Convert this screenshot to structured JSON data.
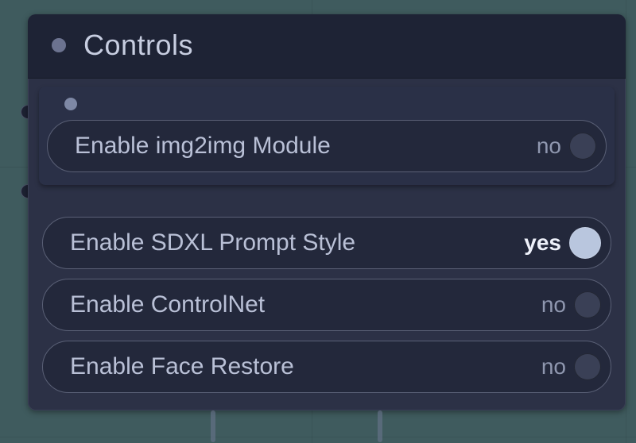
{
  "panel": {
    "title": "Controls",
    "toggles": [
      {
        "id": "img2img",
        "label": "Enable img2img Module",
        "value": "no",
        "on": false
      },
      {
        "id": "sdxl-style",
        "label": "Enable SDXL Prompt Style",
        "value": "yes",
        "on": true
      },
      {
        "id": "controlnet",
        "label": "Enable ControlNet",
        "value": "no",
        "on": false
      },
      {
        "id": "face-restore",
        "label": "Enable Face Restore",
        "value": "no",
        "on": false
      }
    ]
  }
}
